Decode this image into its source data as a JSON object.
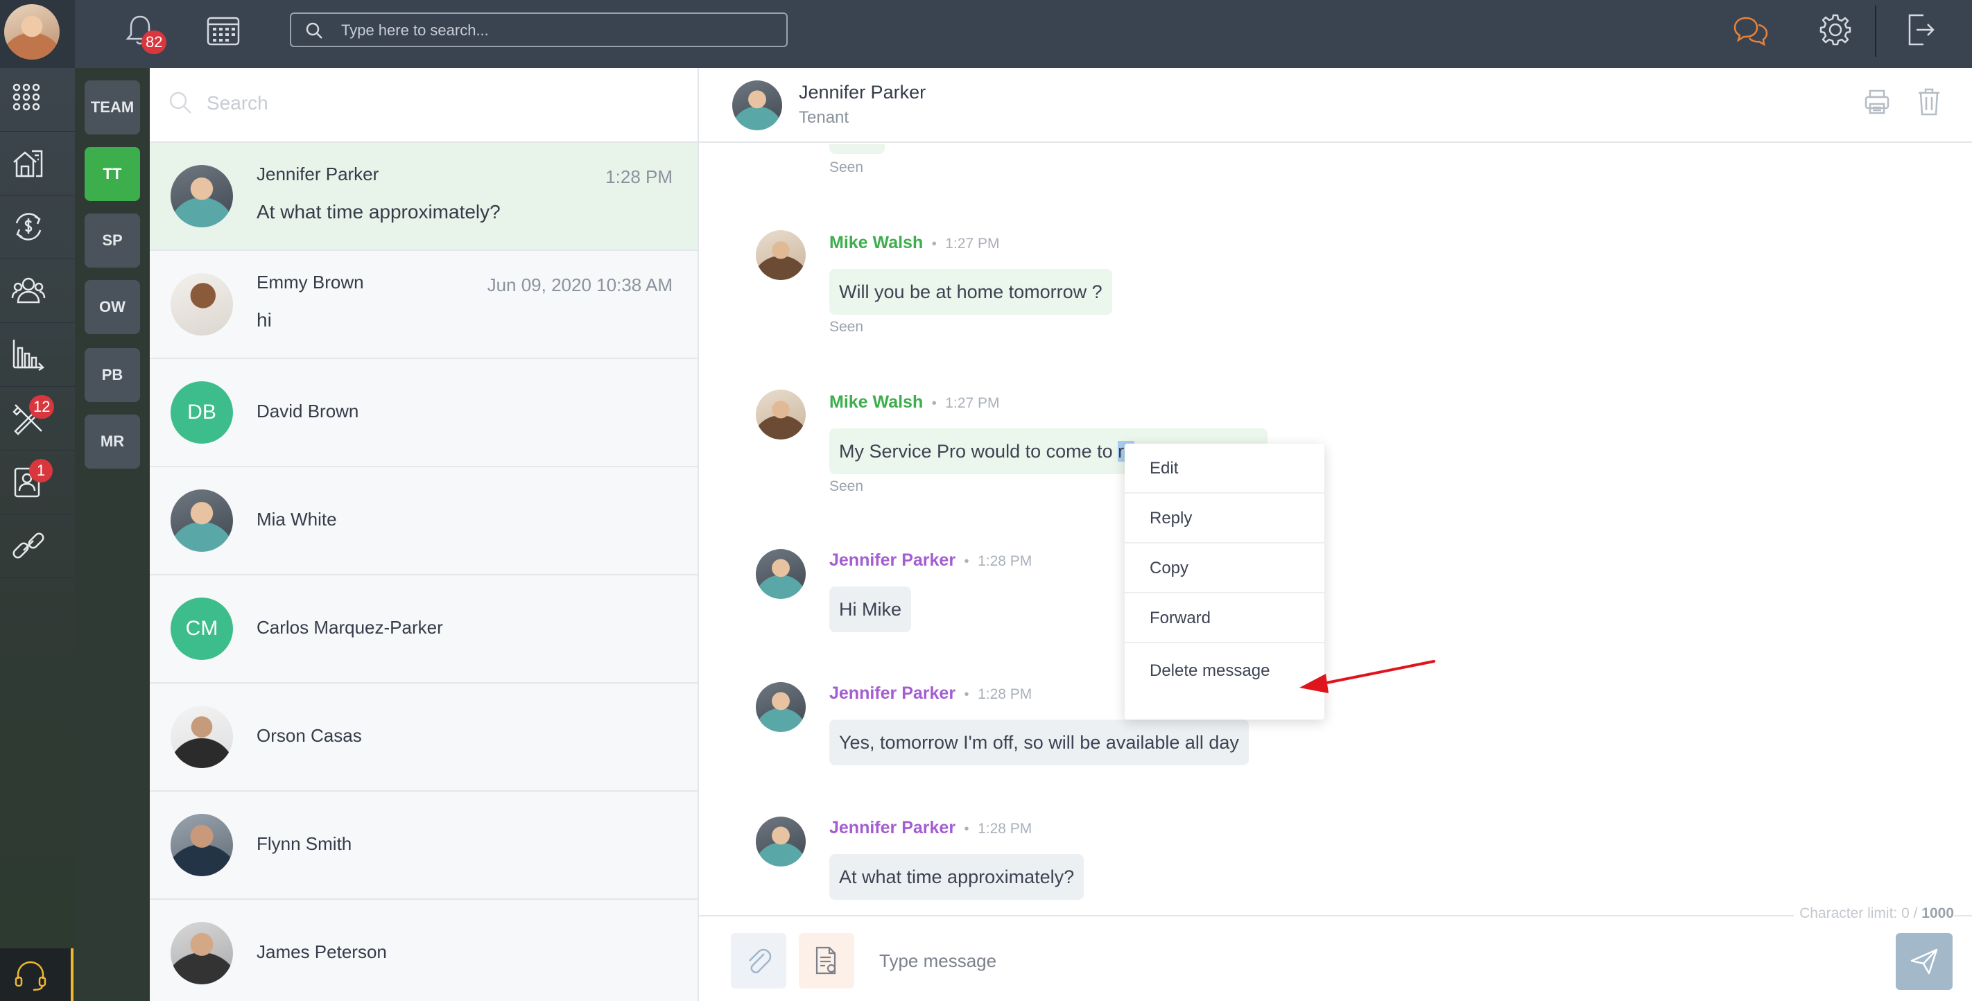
{
  "topbar": {
    "notifications_count": "82",
    "search_placeholder": "Type here to search..."
  },
  "leftnav": {
    "items": [
      {
        "icon": "apps-grid-icon"
      },
      {
        "icon": "properties-icon"
      },
      {
        "icon": "payments-icon"
      },
      {
        "icon": "contacts-icon"
      },
      {
        "icon": "reports-icon"
      },
      {
        "icon": "maintenance-icon",
        "badge": "12"
      },
      {
        "icon": "applicants-icon",
        "badge": "1"
      },
      {
        "icon": "link-icon"
      }
    ],
    "help_icon": "headset-icon"
  },
  "filters": [
    "TEAM",
    "TT",
    "SP",
    "OW",
    "PB",
    "MR"
  ],
  "conversation_list": {
    "search_placeholder": "Search",
    "items": [
      {
        "name": "Jennifer Parker",
        "time": "1:28 PM",
        "preview": "At what time approximately?"
      },
      {
        "name": "Emmy Brown",
        "time": "Jun 09, 2020 10:38 AM",
        "preview": "hi"
      },
      {
        "name": "David Brown",
        "initials": "DB"
      },
      {
        "name": "Mia White"
      },
      {
        "name": "Carlos Marquez-Parker",
        "initials": "CM"
      },
      {
        "name": "Orson Casas"
      },
      {
        "name": "Flynn Smith"
      },
      {
        "name": "James Peterson"
      }
    ]
  },
  "chat": {
    "header": {
      "name": "Jennifer Parker",
      "role": "Tenant"
    },
    "top_seen": "Seen",
    "messages": [
      {
        "sender": "Mike Walsh",
        "time": "1:27 PM",
        "text": "Will you be at home tomorrow ?",
        "status": "Seen"
      },
      {
        "sender": "Mike Walsh",
        "time": "1:27 PM",
        "text_before": "My Service Pro would to come to ",
        "text_selected": "re",
        "text_after": "",
        "status": "Seen"
      },
      {
        "sender": "Jennifer Parker",
        "time": "1:28 PM",
        "text": "Hi Mike"
      },
      {
        "sender": "Jennifer Parker",
        "time": "1:28 PM",
        "text": "Yes, tomorrow I'm off, so will be available all day"
      },
      {
        "sender": "Jennifer Parker",
        "time": "1:28 PM",
        "text": "At what time approximately?"
      }
    ],
    "context_menu": [
      "Edit",
      "Reply",
      "Copy",
      "Forward",
      "Delete message"
    ],
    "char_limit": {
      "label": "Character limit: 0 / ",
      "max": "1000"
    },
    "composer_placeholder": "Type message"
  },
  "colors": {
    "brand_green": "#3dae4c",
    "agent_name": "#3dae4c",
    "tenant_name": "#a35dd1",
    "badge_red": "#d9363e",
    "arrow_red": "#e0141c"
  }
}
